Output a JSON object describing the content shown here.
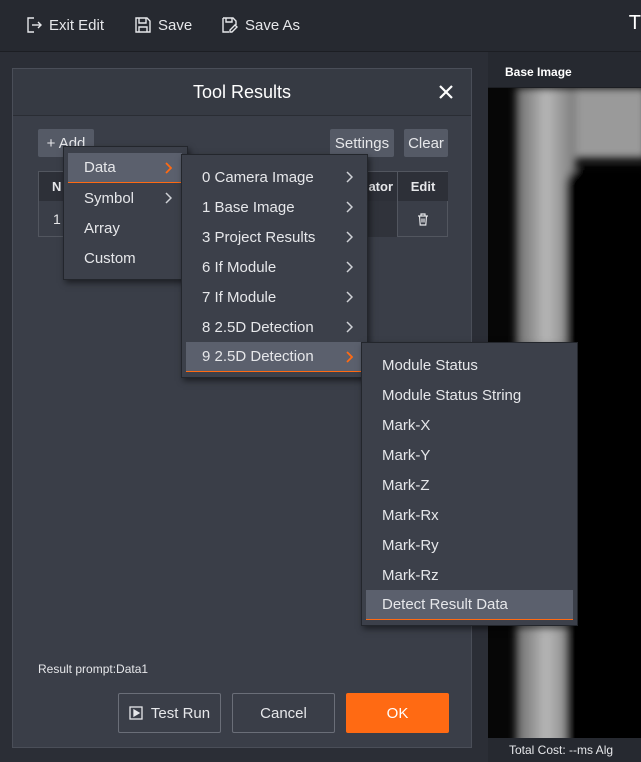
{
  "toolbar": {
    "exit_edit": "Exit Edit",
    "save": "Save",
    "save_as": "Save As",
    "title_fragment": "T"
  },
  "image_panel": {
    "header": "Base Image",
    "status": "Total Cost: --ms   Alg"
  },
  "dialog": {
    "title": "Tool Results",
    "add_label": "+ Add",
    "settings_label": "Settings",
    "clear_label": "Clear",
    "table": {
      "headers": [
        "N",
        "ator",
        "Edit"
      ],
      "row_index": "1"
    },
    "result_prompt": "Result prompt:Data1",
    "test_run_label": "Test Run",
    "cancel_label": "Cancel",
    "ok_label": "OK"
  },
  "menu_level1": {
    "items": [
      "Data",
      "Symbol",
      "Array",
      "Custom"
    ],
    "selected": "Data"
  },
  "menu_level2": {
    "items": [
      "0 Camera Image",
      "1 Base Image",
      "3 Project Results",
      "6 If Module",
      "7 If Module",
      "8 2.5D Detection",
      "9 2.5D Detection"
    ],
    "selected": "9 2.5D Detection"
  },
  "menu_level3": {
    "items": [
      "Module Status",
      "Module Status String",
      "Mark-X",
      "Mark-Y",
      "Mark-Z",
      "Mark-Rx",
      "Mark-Ry",
      "Mark-Rz",
      "Detect Result Data"
    ],
    "selected": "Detect Result Data"
  },
  "colors": {
    "accent": "#ff6a13",
    "background": "#2b2e36",
    "dialog": "#3a3e48",
    "menu": "#3c404a",
    "menu_selected": "#5b606d"
  },
  "icons": [
    "exit-edit-icon",
    "save-icon",
    "save-as-icon",
    "close-icon",
    "trash-icon",
    "play-icon",
    "chevron-right-icon"
  ]
}
